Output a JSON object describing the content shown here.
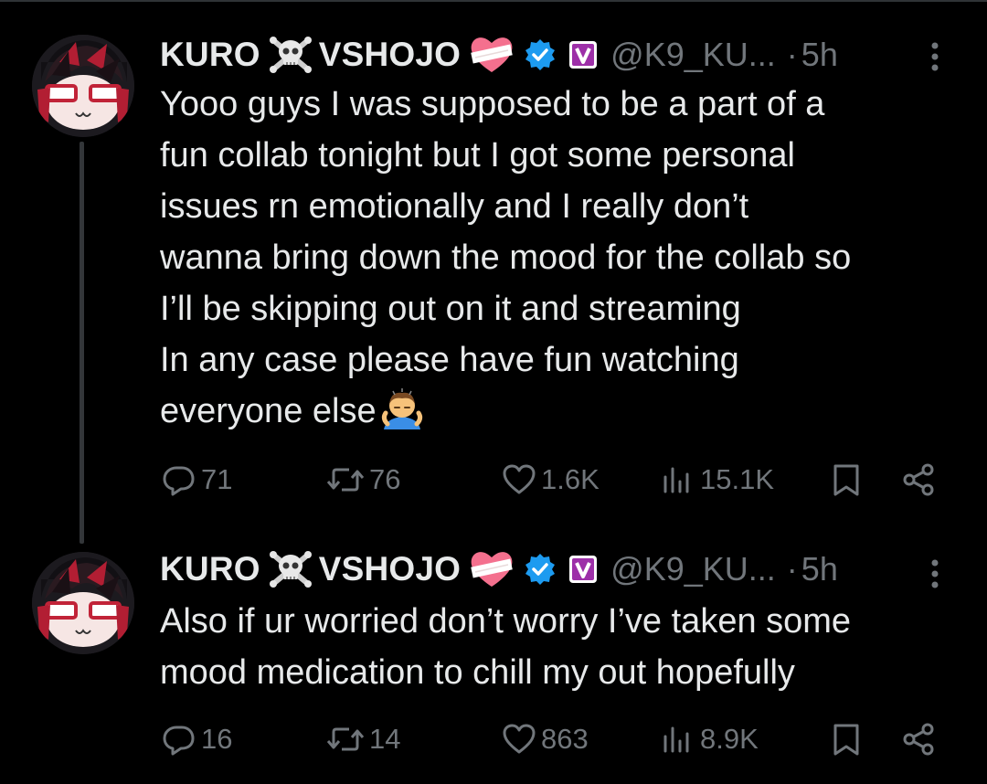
{
  "tweets": [
    {
      "display_name_part1": "KURO",
      "display_name_part2": "VSHOJO",
      "handle": "@K9_KU...",
      "separator": "·",
      "time": "5h",
      "text": "Yooo guys I was supposed to be a part of a\nfun collab tonight but I got some personal\nissues rn emotionally and I really don’t\nwanna bring down the mood for the collab so\nI’ll be skipping out on it and streaming\nIn any case please have fun watching\neveryone else",
      "emoji": "person-bowing-emoji",
      "stats": {
        "replies": "71",
        "reposts": "76",
        "likes": "1.6K",
        "views": "15.1K"
      }
    },
    {
      "display_name_part1": "KURO",
      "display_name_part2": "VSHOJO",
      "handle": "@K9_KU...",
      "separator": "·",
      "time": "5h",
      "text": "Also if ur worried don’t worry I’ve taken some\nmood medication to chill my out hopefully",
      "stats": {
        "replies": "16",
        "reposts": "14",
        "likes": "863",
        "views": "8.9K"
      }
    }
  ],
  "icons": {
    "name_emoji_1": "skull-crossbones-icon",
    "name_emoji_2": "mending-heart-icon",
    "verified": "verified-badge-icon",
    "affiliate": "vshojo-v-badge-icon",
    "more": "more-options-icon",
    "reply": "reply-icon",
    "repost": "repost-icon",
    "like": "heart-icon",
    "views": "views-icon",
    "bookmark": "bookmark-icon",
    "share": "share-icon"
  },
  "colors": {
    "background": "#000000",
    "text": "#e7e9ea",
    "muted": "#71767b",
    "thread_line": "#333639",
    "verified_blue": "#1d9bf0",
    "v_badge_purple": "#9d2fa8",
    "heart_pink": "#f25a7c"
  }
}
